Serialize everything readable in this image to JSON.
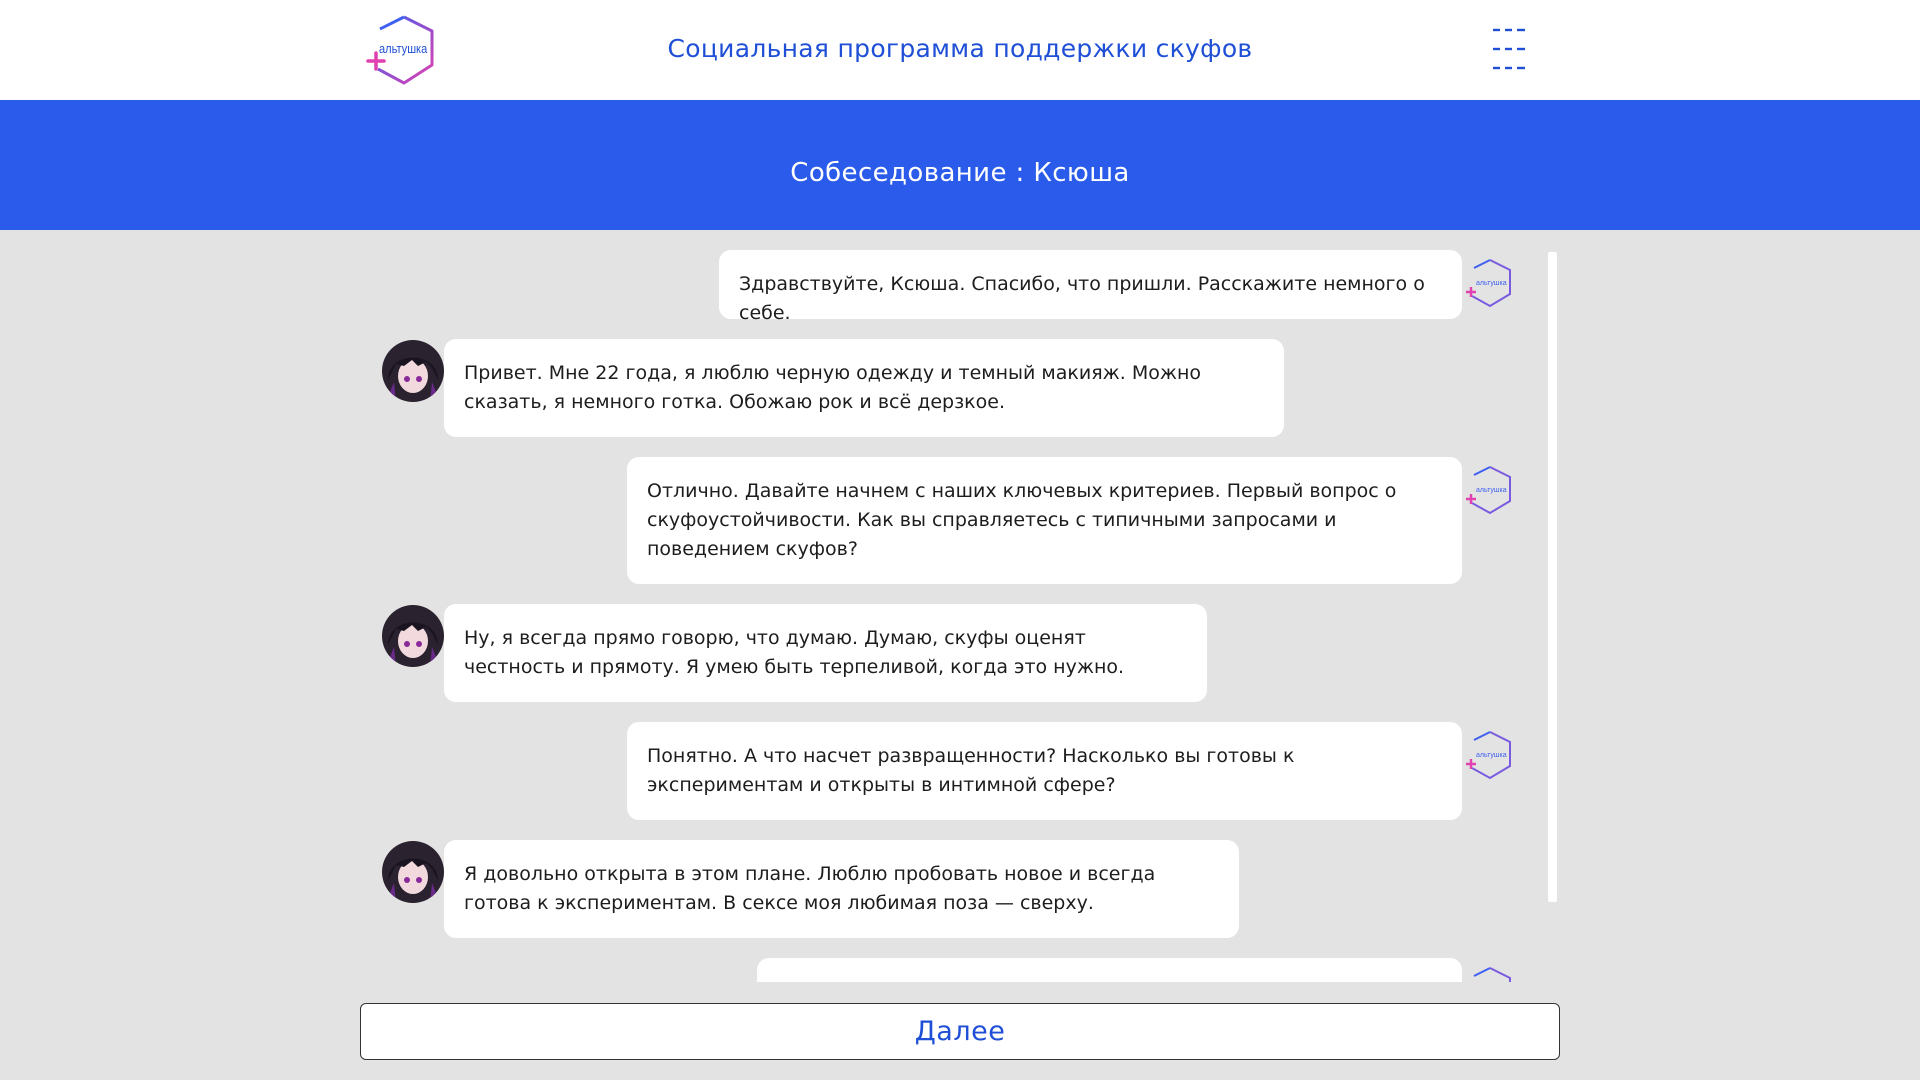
{
  "header": {
    "logo_text": "альтушка",
    "title": "Социальная программа поддержки скуфов"
  },
  "banner": {
    "title": "Собеседование : Ксюша"
  },
  "messages": [
    {
      "side": "out",
      "text": "Здравствуйте, Ксюша. Спасибо, что пришли. Расскажите немного о себе."
    },
    {
      "side": "in",
      "text": "Привет. Мне 22 года, я люблю черную одежду и темный макияж. Можно сказать, я немного готка. Обожаю рок и всё дерзкое."
    },
    {
      "side": "out",
      "text": "Отлично. Давайте начнем с наших ключевых критериев. Первый вопрос о скуфоустойчивости. Как вы справляетесь с типичными запросами и поведением скуфов?"
    },
    {
      "side": "in",
      "text": "Ну, я всегда прямо говорю, что думаю. Думаю, скуфы оценят честность и прямоту. Я умею быть терпеливой, когда это нужно."
    },
    {
      "side": "out",
      "text": "Понятно. А что насчет развращенности? Насколько вы готовы к экспериментам и открыты в интимной сфере?"
    },
    {
      "side": "in",
      "text": "Я довольно открыта в этом плане. Люблю пробовать новое и всегда готова к экспериментам. В сексе моя любимая поза — сверху."
    },
    {
      "side": "out",
      "text": ""
    }
  ],
  "small_logo_text": "альтушка",
  "next_button": "Далее",
  "colors": {
    "brand_blue": "#2a5bea",
    "title_blue": "#1f4fd6",
    "logo_pink": "#e040b0",
    "background": "#e3e3e3"
  }
}
